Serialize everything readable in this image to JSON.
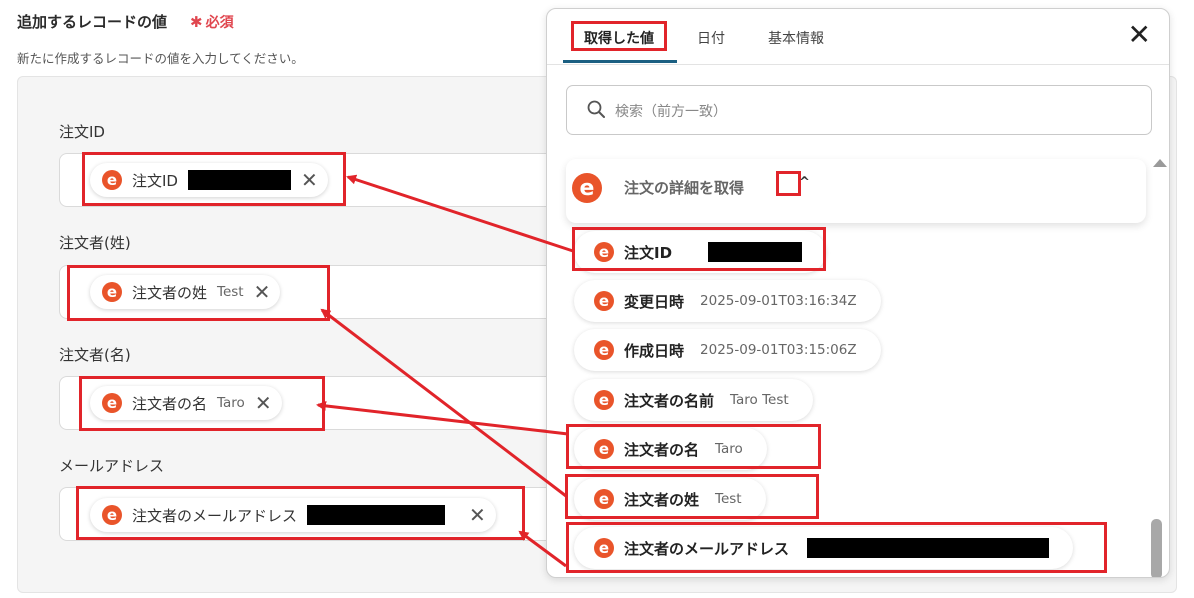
{
  "form": {
    "title": "追加するレコードの値",
    "required_mark": "✱",
    "required_text": "必須",
    "description": "新たに作成するレコードの値を入力してください。",
    "fields": [
      {
        "label": "注文ID",
        "chip_name": "注文ID",
        "chip_value": ""
      },
      {
        "label": "注文者(姓)",
        "chip_name": "注文者の姓",
        "chip_value": "Test"
      },
      {
        "label": "注文者(名)",
        "chip_name": "注文者の名",
        "chip_value": "Taro"
      },
      {
        "label": "メールアドレス",
        "chip_name": "注文者のメールアドレス",
        "chip_value": ""
      }
    ]
  },
  "popup": {
    "tabs": [
      "取得した値",
      "日付",
      "基本情報"
    ],
    "active_tab": "取得した値",
    "close_symbol": "✕",
    "search_placeholder": "検索（前方一致）",
    "group_title": "注文の詳細を取得",
    "group_toggle": "^",
    "items": [
      {
        "name": "注文ID",
        "value": ""
      },
      {
        "name": "変更日時",
        "value": "2025-09-01T03:16:34Z"
      },
      {
        "name": "作成日時",
        "value": "2025-09-01T03:15:06Z"
      },
      {
        "name": "注文者の名前",
        "value": "Taro Test"
      },
      {
        "name": "注文者の名",
        "value": "Taro"
      },
      {
        "name": "注文者の姓",
        "value": "Test"
      },
      {
        "name": "注文者のメールアドレス",
        "value": ""
      }
    ]
  },
  "logo_letter": "e",
  "remove_symbol": "✕",
  "colors": {
    "accent_red": "#e1242a",
    "logo_orange": "#e9542a",
    "tab_underline": "#1b5f82",
    "required_red": "#e0464f"
  }
}
